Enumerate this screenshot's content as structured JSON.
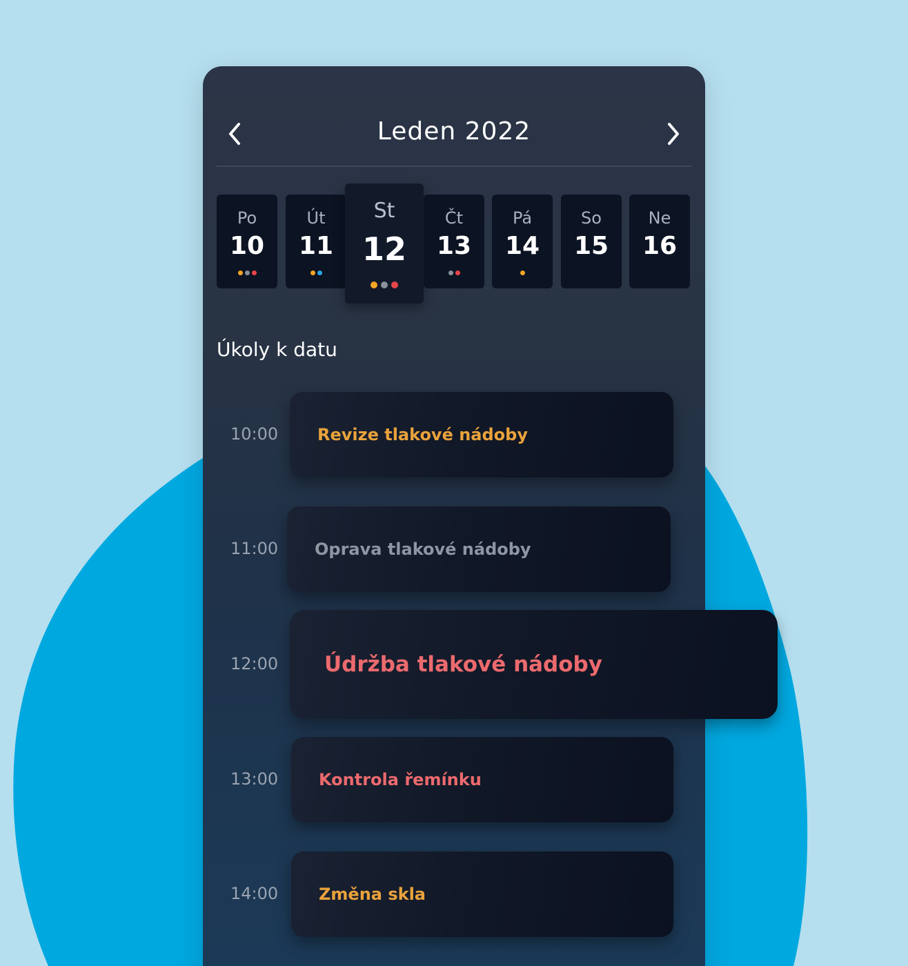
{
  "calendar": {
    "month_title": "Leden 2022",
    "prev_icon": "chevron-left-icon",
    "next_icon": "chevron-right-icon",
    "days": [
      {
        "name": "Po",
        "number": "10",
        "dots": [
          "#f5a623",
          "#8a919c",
          "#e8444a"
        ]
      },
      {
        "name": "Út",
        "number": "11",
        "dots": [
          "#f5a623",
          "#2aa5e6"
        ]
      },
      {
        "name": "St",
        "number": "12",
        "dots": [
          "#f5a623",
          "#8a919c",
          "#e8444a"
        ],
        "selected": true
      },
      {
        "name": "Čt",
        "number": "13",
        "dots": [
          "#8a919c",
          "#e8444a"
        ]
      },
      {
        "name": "Pá",
        "number": "14",
        "dots": [
          "#f5a623"
        ]
      },
      {
        "name": "So",
        "number": "15",
        "dots": []
      },
      {
        "name": "Ne",
        "number": "16",
        "dots": []
      }
    ]
  },
  "tasks_section": {
    "title": "Úkoly k datu",
    "items": [
      {
        "time": "10:00",
        "label": "Revize tlakové nádoby",
        "color": "#e9a23b"
      },
      {
        "time": "11:00",
        "label": "Oprava tlakové nádoby",
        "color": "#8e96a3"
      },
      {
        "time": "12:00",
        "label": "Údržba tlakové nádoby",
        "color": "#ec6a6e",
        "highlighted": true
      },
      {
        "time": "13:00",
        "label": "Kontrola řemínku",
        "color": "#ec6a6e"
      },
      {
        "time": "14:00",
        "label": "Změna skla",
        "color": "#e9a23b"
      }
    ]
  },
  "colors": {
    "background": "#b5dfef",
    "blob": "#00a8e0",
    "panel": "#283344"
  }
}
